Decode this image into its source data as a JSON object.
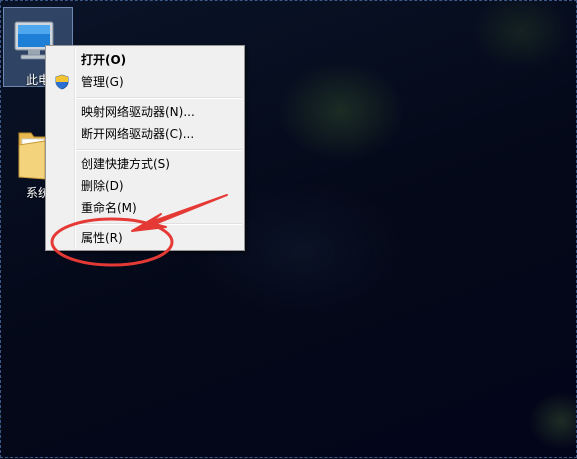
{
  "desktop": {
    "icons": [
      {
        "label": "此电"
      },
      {
        "label": "系统"
      }
    ]
  },
  "context_menu": {
    "items": [
      {
        "label": "打开(O)",
        "bold": true
      },
      {
        "label": "管理(G)",
        "icon": "uac-shield-icon"
      },
      {
        "label": "映射网络驱动器(N)..."
      },
      {
        "label": "断开网络驱动器(C)..."
      },
      {
        "label": "创建快捷方式(S)"
      },
      {
        "label": "删除(D)"
      },
      {
        "label": "重命名(M)"
      },
      {
        "label": "属性(R)"
      }
    ]
  },
  "annotation": {
    "color": "#e53935",
    "shapes": [
      "red-ellipse-annotation",
      "red-arrow-annotation"
    ]
  }
}
